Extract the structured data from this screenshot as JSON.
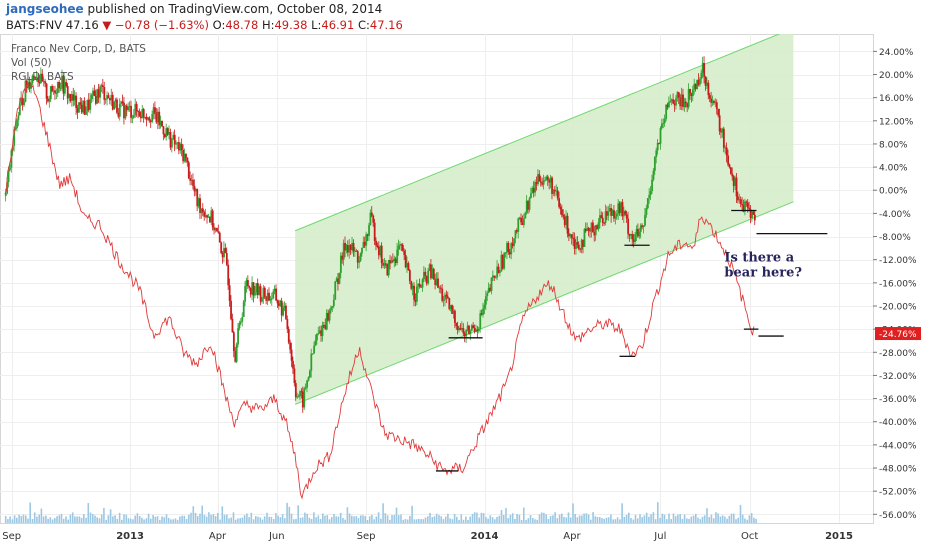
{
  "header": {
    "username": "jangseohee",
    "published_text": "published on TradingView.com, October 08, 2014",
    "symbol": "BATS:FNV",
    "last": "47.16",
    "change_arrow": "▼",
    "change": "−0.78 (−1.63%)",
    "o_label": "O:",
    "o_value": "48.78",
    "h_label": "H:",
    "h_value": "49.38",
    "l_label": "L:",
    "l_value": "46.91",
    "c_label": "C:",
    "c_value": "47.16"
  },
  "legend": {
    "main": "Franco Nev Corp, D, BATS",
    "vol": "Vol (50)",
    "compare": "RGLD, BATS"
  },
  "colors": {
    "up": "#2ea02e",
    "down": "#c81b1b",
    "compare": "#e03a3a",
    "channel_fill": "#d2ecc8",
    "channel_line": "#6fd86f",
    "volume": "#9cc8e3"
  },
  "chart_data": {
    "type": "line",
    "y_axis_unit": "%",
    "y_ticks": [
      "24.00%",
      "20.00%",
      "16.00%",
      "12.00%",
      "8.00%",
      "4.00%",
      "0.00%",
      "-4.00%",
      "-8.00%",
      "-12.00%",
      "-16.00%",
      "-20.00%",
      "-24.00%",
      "-28.00%",
      "-32.00%",
      "-36.00%",
      "-40.00%",
      "-44.00%",
      "-48.00%",
      "-52.00%",
      "-56.00%"
    ],
    "y_tick_values": [
      24,
      20,
      16,
      12,
      8,
      4,
      0,
      -4,
      -8,
      -12,
      -16,
      -20,
      -24,
      -28,
      -32,
      -36,
      -40,
      -44,
      -48,
      -52,
      -56
    ],
    "current_value_label": "-24.76%",
    "current_value": -24.76,
    "x_labels": [
      "Sep",
      "2013",
      "Apr",
      "Jun",
      "Sep",
      "2014",
      "Apr",
      "Jul",
      "Oct",
      "2015"
    ],
    "x_label_dates": [
      "2012-09-01",
      "2013-01-01",
      "2013-04-01",
      "2013-06-01",
      "2013-09-01",
      "2014-01-01",
      "2014-04-01",
      "2014-07-01",
      "2014-10-01",
      "2015-01-01"
    ],
    "annotation": "Is there a bear here?",
    "series": [
      {
        "name": "Franco Nev Corp, D, BATS",
        "style": "candles",
        "points": [
          [
            "2012-08-25",
            -1.0
          ],
          [
            "2012-09-05",
            12.0
          ],
          [
            "2012-09-15",
            18.0
          ],
          [
            "2012-09-25",
            20.5
          ],
          [
            "2012-10-08",
            16.0
          ],
          [
            "2012-10-20",
            19.0
          ],
          [
            "2012-11-01",
            15.5
          ],
          [
            "2012-11-15",
            14.0
          ],
          [
            "2012-12-01",
            17.5
          ],
          [
            "2012-12-20",
            14.0
          ],
          [
            "2013-01-10",
            13.5
          ],
          [
            "2013-01-25",
            13.0
          ],
          [
            "2013-02-10",
            9.0
          ],
          [
            "2013-02-25",
            6.0
          ],
          [
            "2013-03-10",
            -2.0
          ],
          [
            "2013-03-25",
            -5.0
          ],
          [
            "2013-04-10",
            -13.0
          ],
          [
            "2013-04-18",
            -28.5
          ],
          [
            "2013-04-30",
            -16.0
          ],
          [
            "2013-05-15",
            -18.0
          ],
          [
            "2013-05-30",
            -18.5
          ],
          [
            "2013-06-10",
            -22.0
          ],
          [
            "2013-06-20",
            -35.0
          ],
          [
            "2013-06-27",
            -36.5
          ],
          [
            "2013-07-10",
            -26.0
          ],
          [
            "2013-07-25",
            -21.0
          ],
          [
            "2013-08-10",
            -9.0
          ],
          [
            "2013-08-25",
            -12.0
          ],
          [
            "2013-09-05",
            -5.0
          ],
          [
            "2013-09-20",
            -14.0
          ],
          [
            "2013-10-05",
            -10.0
          ],
          [
            "2013-10-20",
            -18.0
          ],
          [
            "2013-11-05",
            -14.0
          ],
          [
            "2013-11-20",
            -19.0
          ],
          [
            "2013-12-10",
            -25.0
          ],
          [
            "2013-12-25",
            -23.0
          ],
          [
            "2014-01-10",
            -15.0
          ],
          [
            "2014-01-25",
            -10.0
          ],
          [
            "2014-02-10",
            -4.0
          ],
          [
            "2014-02-25",
            2.5
          ],
          [
            "2014-03-10",
            1.0
          ],
          [
            "2014-03-20",
            -4.0
          ],
          [
            "2014-04-05",
            -9.5
          ],
          [
            "2014-04-20",
            -7.0
          ],
          [
            "2014-05-05",
            -4.0
          ],
          [
            "2014-05-20",
            -3.0
          ],
          [
            "2014-06-02",
            -8.5
          ],
          [
            "2014-06-12",
            -7.0
          ],
          [
            "2014-06-25",
            6.0
          ],
          [
            "2014-07-10",
            16.0
          ],
          [
            "2014-07-25",
            15.0
          ],
          [
            "2014-08-05",
            18.0
          ],
          [
            "2014-08-12",
            21.0
          ],
          [
            "2014-08-25",
            14.5
          ],
          [
            "2014-09-10",
            4.0
          ],
          [
            "2014-09-22",
            -3.0
          ],
          [
            "2014-10-01",
            -3.5
          ],
          [
            "2014-10-06",
            -5.5
          ]
        ]
      },
      {
        "name": "RGLD, BATS",
        "style": "line",
        "points": [
          [
            "2012-08-25",
            -1.0
          ],
          [
            "2012-09-05",
            12.0
          ],
          [
            "2012-09-15",
            18.0
          ],
          [
            "2012-09-25",
            17.0
          ],
          [
            "2012-10-08",
            9.0
          ],
          [
            "2012-10-20",
            1.0
          ],
          [
            "2012-11-01",
            2.0
          ],
          [
            "2012-11-15",
            -5.0
          ],
          [
            "2012-12-01",
            -6.0
          ],
          [
            "2012-12-20",
            -12.0
          ],
          [
            "2013-01-10",
            -17.0
          ],
          [
            "2013-01-25",
            -25.0
          ],
          [
            "2013-02-10",
            -22.0
          ],
          [
            "2013-02-25",
            -28.0
          ],
          [
            "2013-03-10",
            -30.0
          ],
          [
            "2013-03-25",
            -26.0
          ],
          [
            "2013-04-10",
            -36.0
          ],
          [
            "2013-04-18",
            -40.0
          ],
          [
            "2013-04-30",
            -37.0
          ],
          [
            "2013-05-15",
            -38.0
          ],
          [
            "2013-05-30",
            -36.0
          ],
          [
            "2013-06-10",
            -40.0
          ],
          [
            "2013-06-20",
            -46.0
          ],
          [
            "2013-06-27",
            -53.0
          ],
          [
            "2013-07-10",
            -48.0
          ],
          [
            "2013-07-25",
            -46.0
          ],
          [
            "2013-08-10",
            -35.0
          ],
          [
            "2013-08-25",
            -27.0
          ],
          [
            "2013-09-05",
            -34.0
          ],
          [
            "2013-09-20",
            -42.0
          ],
          [
            "2013-10-05",
            -43.0
          ],
          [
            "2013-10-20",
            -44.0
          ],
          [
            "2013-11-05",
            -46.0
          ],
          [
            "2013-11-20",
            -48.5
          ],
          [
            "2013-12-10",
            -48.0
          ],
          [
            "2013-12-25",
            -43.0
          ],
          [
            "2014-01-10",
            -38.0
          ],
          [
            "2014-01-25",
            -33.0
          ],
          [
            "2014-02-10",
            -22.0
          ],
          [
            "2014-02-25",
            -18.0
          ],
          [
            "2014-03-10",
            -16.0
          ],
          [
            "2014-03-20",
            -20.0
          ],
          [
            "2014-04-05",
            -26.0
          ],
          [
            "2014-04-20",
            -24.0
          ],
          [
            "2014-05-05",
            -23.0
          ],
          [
            "2014-05-20",
            -24.0
          ],
          [
            "2014-06-02",
            -28.5
          ],
          [
            "2014-06-12",
            -27.0
          ],
          [
            "2014-06-25",
            -19.0
          ],
          [
            "2014-07-10",
            -11.0
          ],
          [
            "2014-07-25",
            -9.0
          ],
          [
            "2014-08-05",
            -10.0
          ],
          [
            "2014-08-12",
            -4.0
          ],
          [
            "2014-08-25",
            -7.0
          ],
          [
            "2014-09-10",
            -12.0
          ],
          [
            "2014-09-22",
            -18.0
          ],
          [
            "2014-10-01",
            -23.0
          ],
          [
            "2014-10-06",
            -24.8
          ]
        ]
      }
    ],
    "channel": {
      "upper": [
        [
          "2013-06-20",
          -7.0
        ],
        [
          "2014-11-15",
          28.0
        ]
      ],
      "lower": [
        [
          "2013-06-20",
          -37.0
        ],
        [
          "2014-11-15",
          -2.0
        ]
      ]
    },
    "support_lines": [
      {
        "start": "2013-11-25",
        "end": "2013-12-30",
        "value": -25.5
      },
      {
        "start": "2014-05-25",
        "end": "2014-06-20",
        "value": -9.5
      },
      {
        "start": "2014-09-12",
        "end": "2014-10-08",
        "value": -3.5
      },
      {
        "start": "2014-10-08",
        "end": "2014-12-20",
        "value": -7.5
      },
      {
        "start": "2013-11-12",
        "end": "2013-12-05",
        "value": -48.5
      },
      {
        "start": "2014-05-20",
        "end": "2014-06-05",
        "value": -28.7
      },
      {
        "start": "2014-09-25",
        "end": "2014-10-10",
        "value": -24.0
      },
      {
        "start": "2014-10-10",
        "end": "2014-11-05",
        "value": -25.2
      }
    ],
    "grid": true
  }
}
